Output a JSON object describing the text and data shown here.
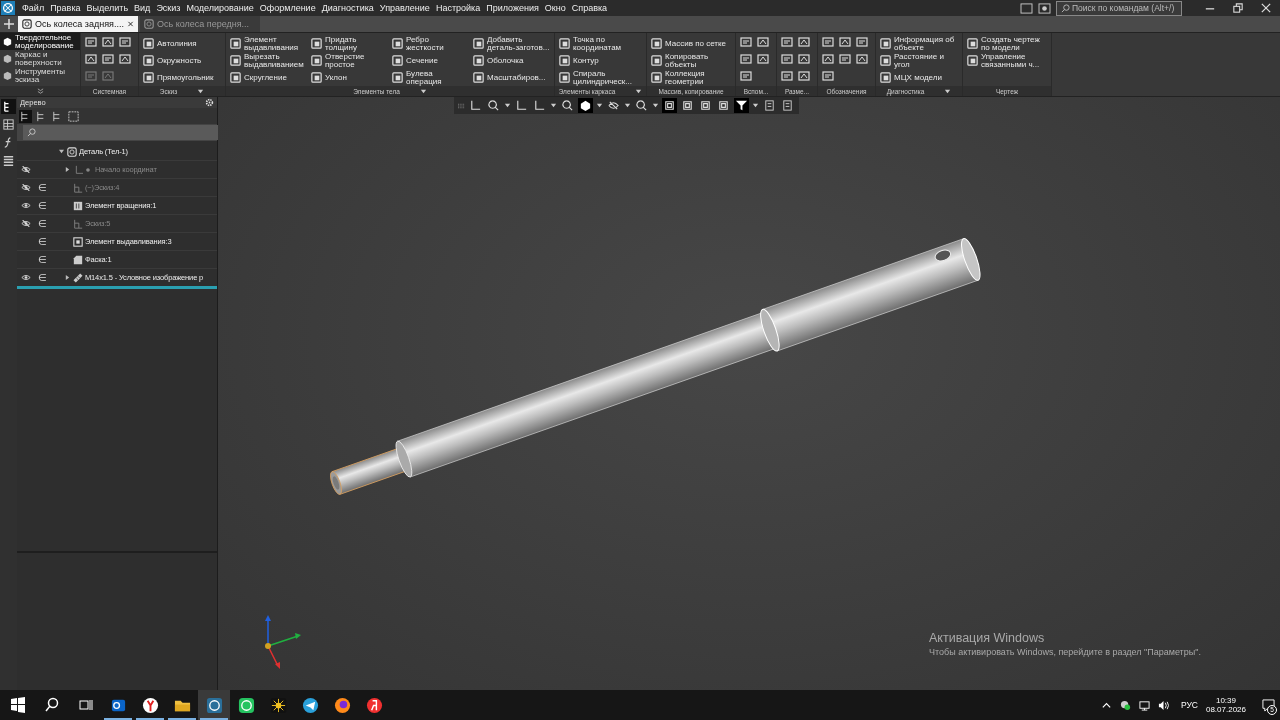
{
  "menu": [
    "Файл",
    "Правка",
    "Выделить",
    "Вид",
    "Эскиз",
    "Моделирование",
    "Оформление",
    "Диагностика",
    "Управление",
    "Настройка",
    "Приложения",
    "Окно",
    "Справка"
  ],
  "search": {
    "placeholder": "Поиск по командам (Alt+/)"
  },
  "doc_tabs": [
    {
      "label": "Ось колеса задняя....",
      "selected": true
    },
    {
      "label": "Ось колеса передня...",
      "selected": false
    }
  ],
  "modes": [
    {
      "label": "Твердотельное\nмоделирование",
      "selected": true
    },
    {
      "label": "Каркас и\nповерхности",
      "selected": false
    },
    {
      "label": "Инструменты\nэскиза",
      "selected": false
    }
  ],
  "ribbon_groups": [
    {
      "kind": "icons",
      "title": "Системная",
      "menu": false
    },
    {
      "kind": "list",
      "title": "Эскиз",
      "menu": true,
      "columns": [
        [
          "Автолиния",
          "Окружность",
          "Прямоугольник"
        ]
      ]
    },
    {
      "kind": "list",
      "title": "Элементы тела",
      "menu": true,
      "columns": [
        [
          "Элемент\nвыдавливания",
          "Вырезать\nвыдавливанием",
          "Скругление"
        ],
        [
          "Придать\nтолщину",
          "Отверстие\nпростое",
          "Уклон"
        ],
        [
          "Ребро\nжесткости",
          "Сечение",
          "Булева\nоперация"
        ],
        [
          "Добавить\nдеталь-заготов...",
          "Оболочка",
          "Масштабиров..."
        ]
      ]
    },
    {
      "kind": "list",
      "title": "Элементы каркаса",
      "menu": true,
      "columns": [
        [
          "Точка по\nкоординатам",
          "Контур",
          "Спираль\nцилиндрическ..."
        ]
      ]
    },
    {
      "kind": "list",
      "title": "Массив, копирование",
      "menu": false,
      "columns": [
        [
          "Массив по сетке",
          "Копировать\nобъекты",
          "Коллекция\nгеометрии"
        ]
      ]
    },
    {
      "kind": "icons",
      "title": "Вспом...",
      "menu": false
    },
    {
      "kind": "icons",
      "title": "Разме...",
      "menu": false
    },
    {
      "kind": "icons",
      "title": "Обозначения",
      "menu": false
    },
    {
      "kind": "list",
      "title": "Диагностика",
      "menu": true,
      "columns": [
        [
          "Информация об\nобъекте",
          "Расстояние и\nугол",
          "МЦХ модели"
        ]
      ]
    },
    {
      "kind": "list",
      "title": "Чертеж",
      "menu": false,
      "columns": [
        [
          "Создать чертеж\nпо модели",
          "Управление\nсвязанными ч..."
        ]
      ]
    }
  ],
  "tree": {
    "title": "Дерево",
    "items": [
      {
        "kind": "part",
        "label": "Деталь (Тел-1)",
        "expanded": true,
        "children": [
          {
            "kind": "origin",
            "label": "Начало координат",
            "eye_shown": false,
            "dimmed": true,
            "expanded": false
          },
          {
            "kind": "sketch",
            "label": "(−)Эскиз:4",
            "eye_shown": false,
            "body_mark": "∈",
            "dimmed": true
          },
          {
            "kind": "revolve",
            "label": "Элемент вращения:1",
            "eye_shown": true,
            "body_mark": "∈",
            "dimmed": false
          },
          {
            "kind": "sketch",
            "label": "Эскиз:5",
            "eye_shown": false,
            "body_mark": "∈",
            "dimmed": true
          },
          {
            "kind": "extrude",
            "label": "Элемент выдавливания:3",
            "body_mark": "∈",
            "dimmed": false
          },
          {
            "kind": "chamfer",
            "label": "Фаска:1",
            "body_mark": "∈",
            "dimmed": false
          },
          {
            "kind": "thread",
            "label": "M14x1.5 - Условное изображение р",
            "eye_shown": true,
            "body_mark": "∈",
            "dimmed": false,
            "expanded": false
          }
        ]
      }
    ]
  },
  "activation": {
    "title": "Активация Windows",
    "text": "Чтобы активировать Windows, перейдите в раздел \"Параметры\"."
  },
  "taskbar": {
    "apps": [
      {
        "kind": "mail",
        "running": true,
        "selected": false
      },
      {
        "kind": "browser",
        "running": true,
        "selected": false
      },
      {
        "kind": "folder",
        "running": true,
        "selected": false
      },
      {
        "kind": "cad",
        "running": true,
        "selected": true
      },
      {
        "kind": "chat",
        "running": false,
        "selected": false
      },
      {
        "kind": "sun",
        "running": false,
        "selected": false
      },
      {
        "kind": "messenger",
        "running": false,
        "selected": false
      },
      {
        "kind": "firefox",
        "running": false,
        "selected": false
      },
      {
        "kind": "browser2",
        "running": false,
        "selected": false
      }
    ],
    "language": "РУС",
    "time": "10:39",
    "date": "08.07.2026",
    "notifications": "5"
  }
}
